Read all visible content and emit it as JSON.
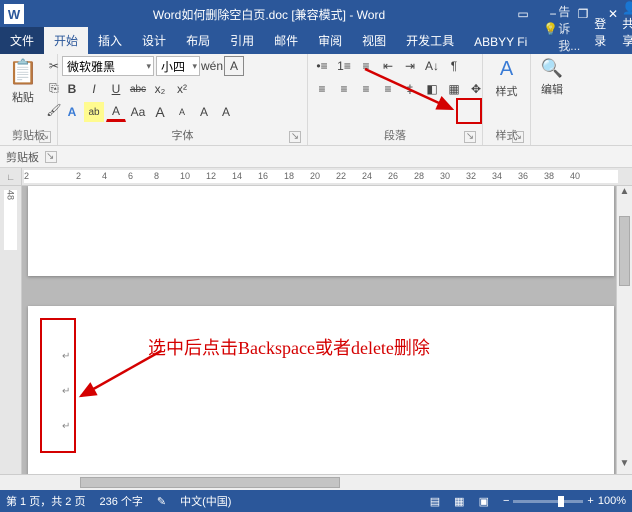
{
  "title": "Word如何删除空白页.doc [兼容模式] - Word",
  "window": {
    "icon": "W"
  },
  "tabs": {
    "file": "文件",
    "home": "开始",
    "insert": "插入",
    "design": "设计",
    "layout": "布局",
    "references": "引用",
    "mailings": "邮件",
    "review": "审阅",
    "view": "视图",
    "developer": "开发工具",
    "abbyy": "ABBYY Fi"
  },
  "tell_me": "告诉我...",
  "login": "登录",
  "share": "共享",
  "clipboard": {
    "label": "剪贴板",
    "paste": "粘贴"
  },
  "font": {
    "label": "字体",
    "family": "微软雅黑",
    "size": "小四",
    "bold": "B",
    "italic": "I",
    "underline": "U",
    "strike": "abc",
    "sub": "x₂",
    "sup": "x²",
    "phonetic": "wén",
    "charborder": "A",
    "texteffect": "A",
    "highlight": "ab",
    "fontcolor": "A",
    "grow": "A",
    "shrink": "A",
    "clear": "A",
    "change": "Aa"
  },
  "paragraph": {
    "label": "段落",
    "bullets": "≡",
    "numbering": "≡",
    "multilevel": "≡",
    "dec_indent": "≡",
    "inc_indent": "≡",
    "sort": "A↓",
    "show_marks": "¶",
    "align_l": "≡",
    "align_c": "≡",
    "align_r": "≡",
    "align_j": "≡",
    "line_spacing": "‡",
    "shading": "◧",
    "borders": "▦",
    "snap": "✥"
  },
  "styles": {
    "label": "样式",
    "btn": "样式"
  },
  "editing": {
    "label": "编辑"
  },
  "secondary": {
    "clipboard_pane": "剪贴板"
  },
  "ruler_ticks": [
    "2",
    "",
    "2",
    "4",
    "6",
    "8",
    "10",
    "12",
    "14",
    "16",
    "18",
    "20",
    "22",
    "24",
    "26",
    "28",
    "30",
    "32",
    "34",
    "36",
    "38",
    "40"
  ],
  "vruler_mark": "48",
  "annotation": "选中后点击Backspace或者delete删除",
  "para_mark": "↵",
  "status": {
    "page": "第 1 页，共 2 页",
    "words": "236 个字",
    "lang": "中文(中国)",
    "zoom": "100%",
    "minus": "−",
    "plus": "+"
  }
}
